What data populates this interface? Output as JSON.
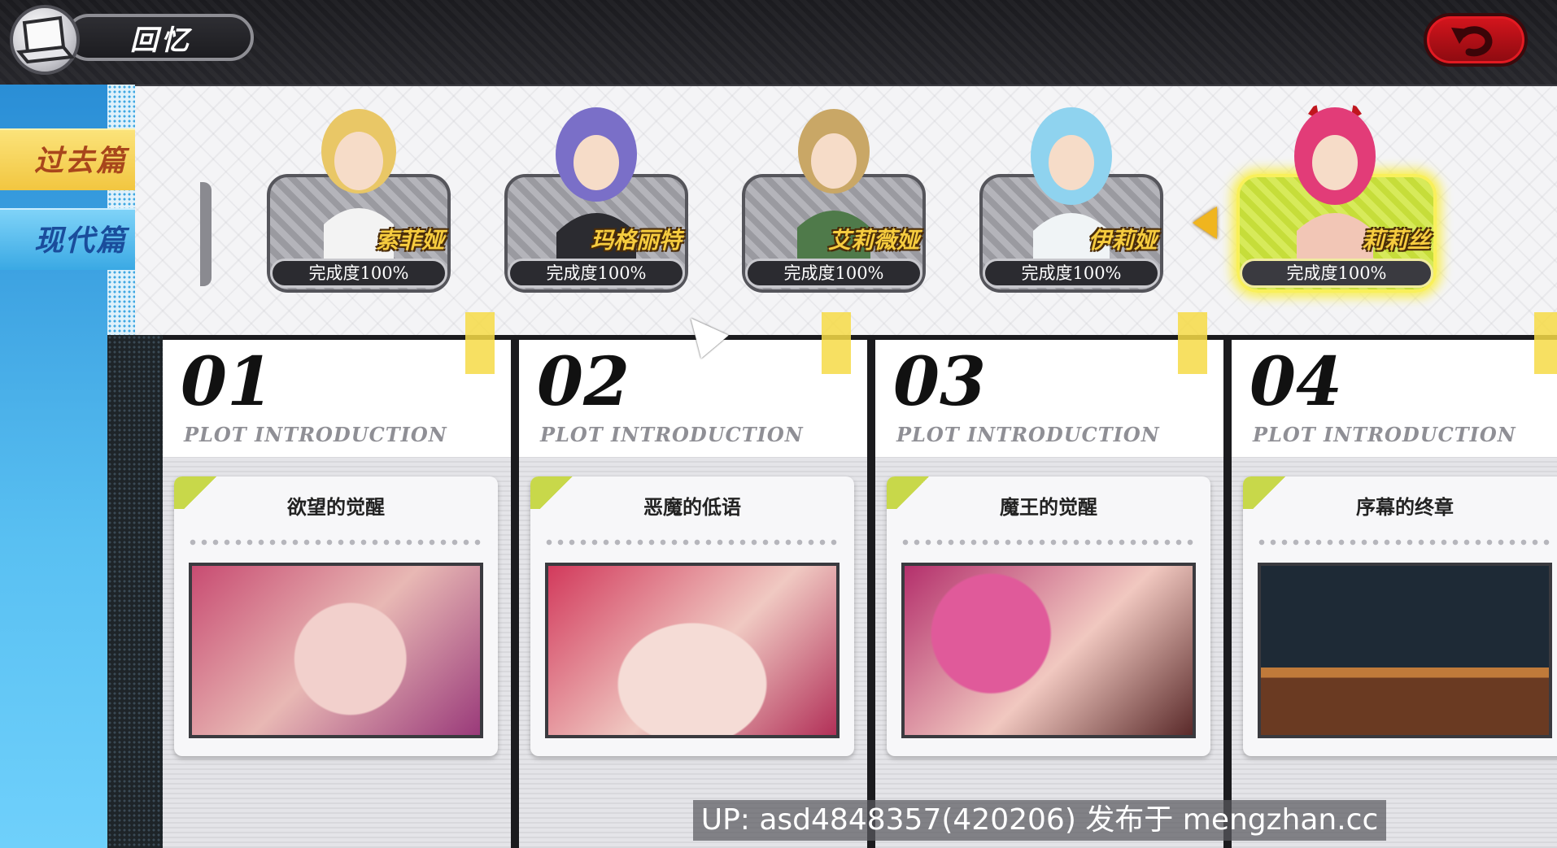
{
  "header": {
    "title": "回忆",
    "menu_icon": "laptop-icon",
    "back_icon": "return-arrow-icon",
    "colors": {
      "back_button": "#c8141c",
      "bar": "#1f1f23"
    }
  },
  "sidebar": {
    "tabs": [
      {
        "label": "过去篇",
        "color": "#f2c640"
      },
      {
        "label": "现代篇",
        "color": "#3aa9e4"
      }
    ]
  },
  "characters": [
    {
      "name": "索菲娅",
      "completion": "完成度100%",
      "hair": "#e9c766"
    },
    {
      "name": "玛格丽特",
      "completion": "完成度100%",
      "hair": "#7a6fc8"
    },
    {
      "name": "艾莉薇娅",
      "completion": "完成度100%",
      "hair": "#c9a766"
    },
    {
      "name": "伊莉娅",
      "completion": "完成度100%",
      "hair": "#8fd3ef"
    },
    {
      "name": "莉莉丝",
      "completion": "完成度100%",
      "hair": "#e23c78",
      "selected": true
    }
  ],
  "scenes": [
    {
      "number": "01",
      "subtitle": "PLOT INTRODUCTION",
      "title": "欲望的觉醒"
    },
    {
      "number": "02",
      "subtitle": "PLOT INTRODUCTION",
      "title": "恶魔的低语"
    },
    {
      "number": "03",
      "subtitle": "PLOT INTRODUCTION",
      "title": "魔王的觉醒"
    },
    {
      "number": "04",
      "subtitle": "PLOT INTRODUCTION",
      "title": "序幕的终章"
    }
  ],
  "watermark": "UP: asd4848357(420206) 发布于 mengzhan.cc"
}
